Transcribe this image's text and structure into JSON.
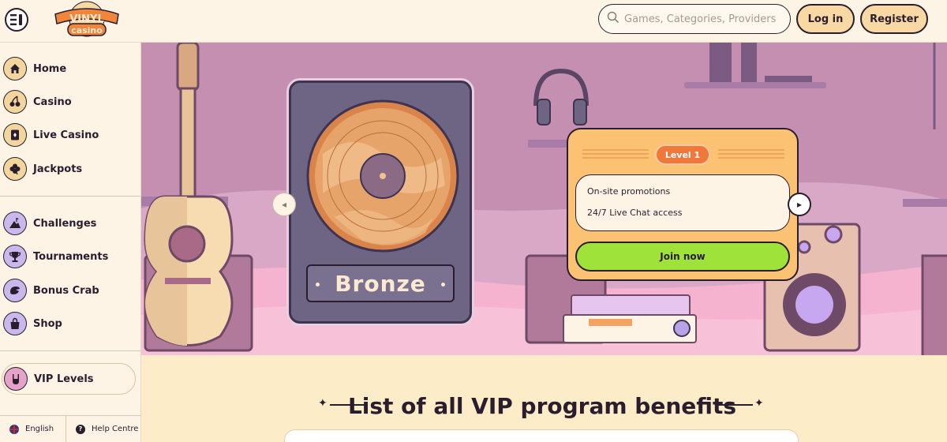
{
  "header": {
    "menu_icon": "sidebar-toggle-icon",
    "logo_top": "VINYL",
    "logo_bottom": "casino",
    "search_placeholder": "Games, Categories, Providers",
    "login_label": "Log in",
    "register_label": "Register"
  },
  "sidebar": {
    "primary": [
      {
        "label": "Home",
        "icon": "home-icon"
      },
      {
        "label": "Casino",
        "icon": "cherries-icon"
      },
      {
        "label": "Live Casino",
        "icon": "playing-card-icon"
      },
      {
        "label": "Jackpots",
        "icon": "clover-icon"
      }
    ],
    "secondary": [
      {
        "label": "Challenges",
        "icon": "mountain-flag-icon"
      },
      {
        "label": "Tournaments",
        "icon": "trophy-icon"
      },
      {
        "label": "Bonus Crab",
        "icon": "crab-claw-icon"
      },
      {
        "label": "Shop",
        "icon": "shopping-bag-icon"
      }
    ],
    "vip": {
      "label": "VIP Levels",
      "icon": "rock-hand-icon"
    },
    "footer": {
      "language": "English",
      "help": "Help Centre"
    }
  },
  "hero": {
    "tier_name": "Bronze",
    "level_badge": "Level 1",
    "benefits": [
      "On-site promotions",
      "24/7 Live Chat access"
    ],
    "join_label": "Join now",
    "colors": {
      "background": "#c58fb1",
      "panel": "#fbc274",
      "badge": "#f0783b",
      "join": "#9fe33a",
      "card": "#6e6585"
    }
  },
  "benefits_section": {
    "title": "List of all VIP program benefits"
  }
}
